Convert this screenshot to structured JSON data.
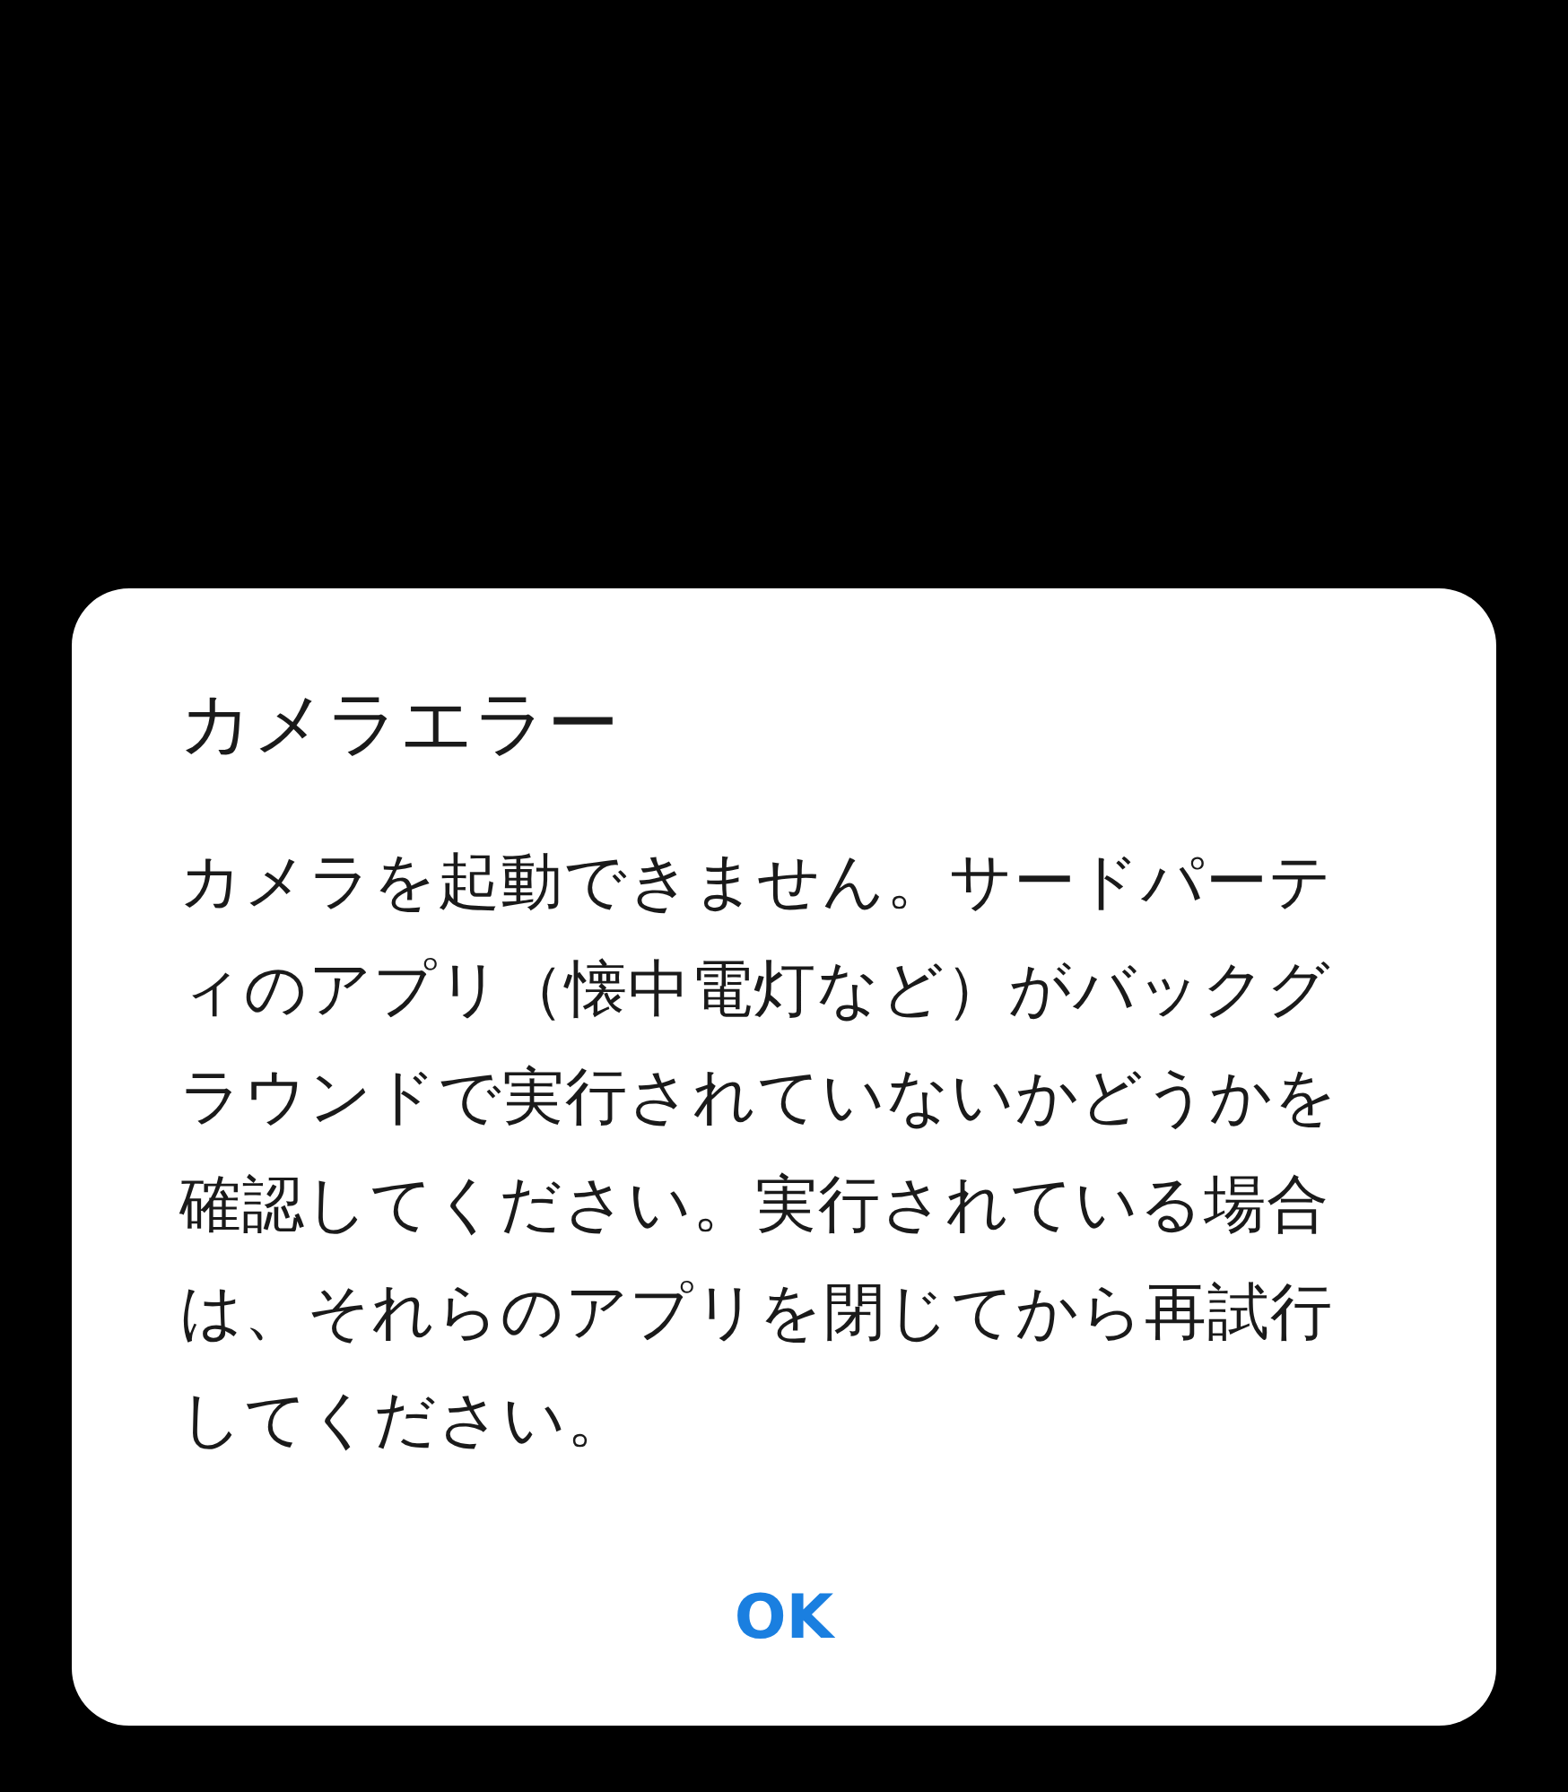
{
  "dialog": {
    "title": "カメラエラー",
    "message": "カメラを起動できません。サードパーティのアプリ（懐中電灯など）がバックグラウンドで実行されていないかどうかを確認してください。実行されている場合は、それらのアプリを閉じてから再試行してください。",
    "buttons": [
      "OK"
    ]
  }
}
